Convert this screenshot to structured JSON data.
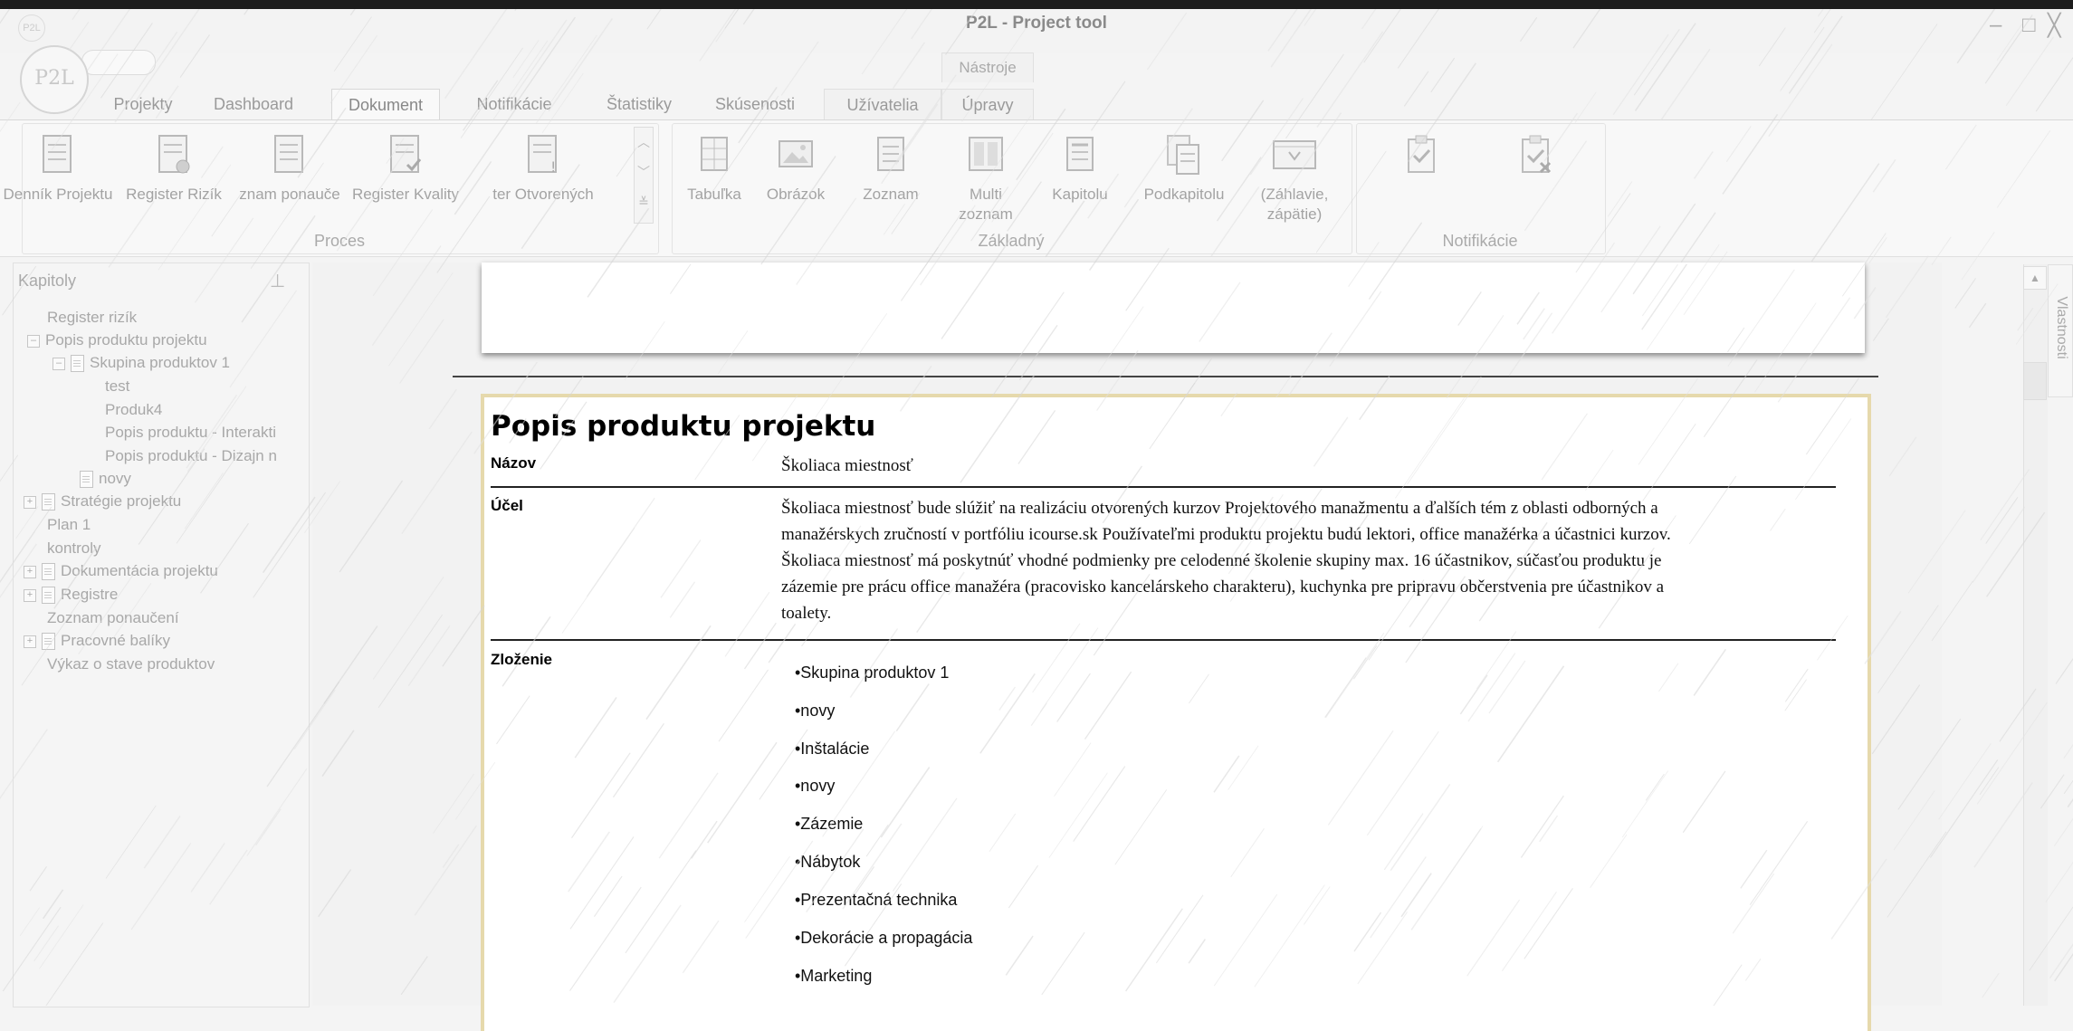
{
  "window": {
    "title": "P2L - Project tool",
    "logo_text": "P2L",
    "controls": {
      "minimize": "–",
      "maximize": "□",
      "close": "╳"
    }
  },
  "ribbon": {
    "context_group": "Nástroje",
    "tabs": [
      "Projekty",
      "Dashboard",
      "Dokument",
      "Notifikácie",
      "Štatistiky",
      "Skúsenosti",
      "Užívatelia",
      "Úpravy"
    ],
    "active_tab": "Dokument",
    "groups": {
      "proces": {
        "label": "Proces",
        "buttons": [
          "Denník Projektu",
          "Register Rizík",
          "Zoznam ponaučení",
          "Register Kvality",
          "Register Otvorených"
        ]
      },
      "zakladny": {
        "label": "Základný",
        "buttons": [
          "Tabuľka",
          "Obrázok",
          "Zoznam",
          "Multi zoznam",
          "Kapitolu",
          "Podkapitolu",
          "(Záhlavie, zápätie)"
        ]
      },
      "notifikacie": {
        "label": "Notifikácie"
      }
    },
    "proces_visible": [
      "Denník Projektu",
      "Register Rizík",
      "znam ponauče",
      "Register Kvality",
      "ter Otvorených"
    ]
  },
  "left_panel": {
    "title": "Kapitoly",
    "tree": [
      "Register rizík",
      "Popis produktu projektu",
      "Skupina produktov 1",
      "test",
      "Produk4",
      "Popis produktu - Interakti",
      "Popis produktu - Dizajn n",
      "novy",
      "Stratégie projektu",
      "Plan 1",
      "kontroly",
      "Dokumentácia projektu",
      "Registre",
      "Zoznam ponaučení",
      "Pracovné balíky",
      "Výkaz o stave produktov"
    ]
  },
  "document": {
    "title": "Popis produktu projektu",
    "rows": {
      "nazov": {
        "label": "Názov",
        "value": "Školiaca miestnosť"
      },
      "ucel": {
        "label": "Účel",
        "lines": [
          "Školiaca miestnosť bude slúžiť na realizáciu otvorených kurzov Projektového manažmentu a ďalších tém z oblasti odborných a",
          "manažérskych zručností v portfóliu icourse.sk Používateľmi produktu projektu budú lektori, office manažérka a účastnici kurzov.",
          "Školiaca miestnosť má poskytnúť vhodné podmienky pre celodenné školenie skupiny max. 16 účastnikov, súčasťou produktu je",
          "zázemie pre prácu office manažéra (pracovisko kancelárskeho charakteru), kuchynka pre pripravu občerstvenia pre účastnikov a",
          "toalety."
        ]
      },
      "zlozenie": {
        "label": "Zloženie",
        "items": [
          "•Skupina produktov 1",
          "•novy",
          "•Inštalácie",
          "•novy",
          "•Zázemie",
          "•Nábytok",
          "•Prezentačná technika",
          "•Dekorácie a propagácia",
          "•Marketing"
        ]
      }
    }
  },
  "right_panel": {
    "tab": "Vlastnosti",
    "scroll_up": "▲"
  }
}
